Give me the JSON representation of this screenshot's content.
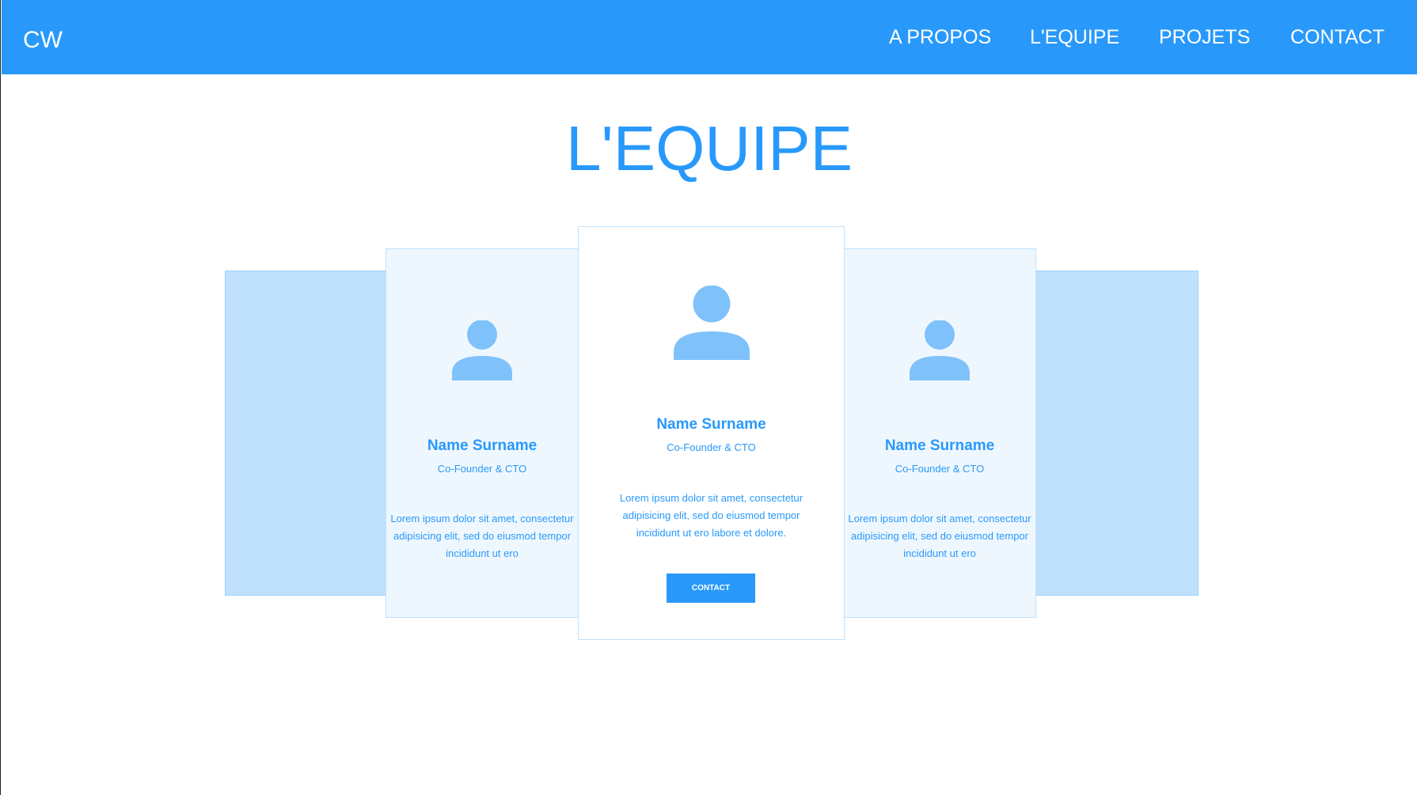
{
  "colors": {
    "primary": "#2899fb",
    "panel_back": "#bfe1fd",
    "card_side_bg": "#eff7fe",
    "avatar": "#7fc1fb"
  },
  "navbar": {
    "brand": "CW",
    "links": [
      "A PROPOS",
      "L'EQUIPE",
      "PROJETS",
      "CONTACT"
    ]
  },
  "section": {
    "title": "L'EQUIPE"
  },
  "team": {
    "cards": [
      {
        "icon": "user-icon",
        "name": "Name Surname",
        "role": "Co-Founder & CTO",
        "description": "Lorem ipsum dolor sit amet, consectetur adipisicing elit, sed do eiusmod tempor incididunt ut ero"
      },
      {
        "icon": "user-icon",
        "name": "Name Surname",
        "role": "Co-Founder & CTO",
        "description": "Lorem ipsum dolor sit amet, consectetur adipisicing elit, sed do eiusmod tempor incididunt ut ero labore et dolore.",
        "button_label": "CONTACT"
      },
      {
        "icon": "user-icon",
        "name": "Name Surname",
        "role": "Co-Founder & CTO",
        "description": "Lorem ipsum dolor sit amet, consectetur adipisicing elit, sed do eiusmod tempor incididunt ut ero"
      }
    ]
  }
}
